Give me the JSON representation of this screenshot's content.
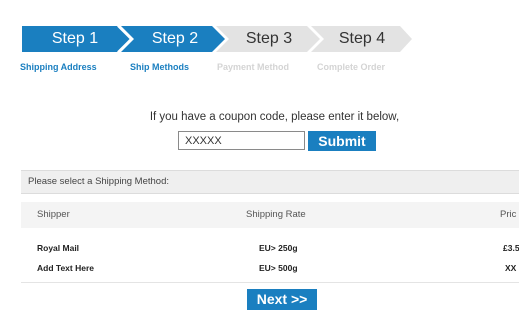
{
  "colors": {
    "accent": "#1a7fc0",
    "inactive_step": "#e3e3e3",
    "inactive_text": "#d4d4d4"
  },
  "steps": [
    {
      "label": "Step 1",
      "state": "active"
    },
    {
      "label": "Step 2",
      "state": "active"
    },
    {
      "label": "Step 3",
      "state": "inactive"
    },
    {
      "label": "Step 4",
      "state": "inactive"
    }
  ],
  "sub_steps": [
    {
      "label": "Shipping Address",
      "state": "active"
    },
    {
      "label": "Ship Methods",
      "state": "active"
    },
    {
      "label": "Payment Method",
      "state": "inactive"
    },
    {
      "label": "Complete Order",
      "state": "inactive"
    }
  ],
  "coupon": {
    "prompt": "If you have a coupon code, please enter it below,",
    "value": "XXXXX",
    "submit_label": "Submit"
  },
  "shipping": {
    "instruction": "Please select a Shipping Method:",
    "columns": [
      "Shipper",
      "Shipping Rate",
      "Pric"
    ],
    "rows": [
      {
        "shipper": "Royal Mail",
        "rate": "EU> 250g",
        "price": "£3.5"
      },
      {
        "shipper": "Add Text Here",
        "rate": "EU> 500g",
        "price": "XX"
      }
    ]
  },
  "next_label": "Next >>"
}
